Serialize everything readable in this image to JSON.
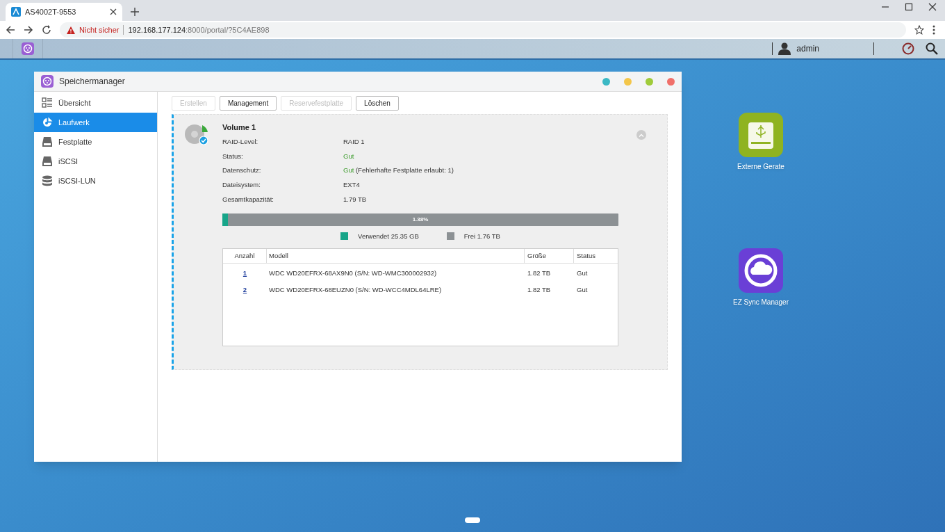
{
  "browser": {
    "tab": {
      "title": "AS4002T-9553"
    },
    "security": "Nicht sicher",
    "url": {
      "host": "192.168.177.124",
      "path": ":8000/portal/?5C4AE898"
    }
  },
  "taskbar": {
    "user": "admin"
  },
  "window": {
    "title": "Speichermanager"
  },
  "sidebar": {
    "items": [
      {
        "label": "Übersicht",
        "kind": "overview",
        "selected": false
      },
      {
        "label": "Laufwerk",
        "kind": "volume",
        "selected": true
      },
      {
        "label": "Festplatte",
        "kind": "disk",
        "selected": false
      },
      {
        "label": "iSCSI",
        "kind": "disk",
        "selected": false
      },
      {
        "label": "iSCSI-LUN",
        "kind": "stack",
        "selected": false
      }
    ]
  },
  "toolbar": {
    "buttons": [
      {
        "label": "Erstellen",
        "disabled": true
      },
      {
        "label": "Management",
        "disabled": false
      },
      {
        "label": "Reservefestplatte",
        "disabled": true
      },
      {
        "label": "Löschen",
        "disabled": false
      }
    ]
  },
  "volume": {
    "name": "Volume 1",
    "properties": [
      {
        "label": "RAID-Level:",
        "value": "RAID 1",
        "kind": "plain"
      },
      {
        "label": "Status:",
        "value": "Gut",
        "kind": "status"
      },
      {
        "label": "Datenschutz:",
        "value": "Gut",
        "note": "(Fehlerhafte Festplatte erlaubt: 1)",
        "kind": "status"
      },
      {
        "label": "Dateisystem:",
        "value": "EXT4",
        "kind": "plain"
      },
      {
        "label": "Gesamtkapazität:",
        "value": "1.79 TB",
        "kind": "plain"
      }
    ],
    "usage": {
      "level": 0.0138,
      "label": "1.38%"
    },
    "legend": [
      {
        "label": "Verwendet 25.35 GB",
        "color": "#17a589"
      },
      {
        "label": "Frei 1.76 TB",
        "color": "#8c9194"
      }
    ],
    "table": {
      "columns": [
        "Anzahl",
        "Modell",
        "Größe",
        "Status"
      ],
      "rows": [
        [
          "1",
          "WDC WD20EFRX-68AX9N0 (S/N: WD-WMC300002932)",
          "1.82 TB",
          "Gut"
        ],
        [
          "2",
          "WDC WD20EFRX-68EUZN0 (S/N: WD-WCC4MDL64LRE)",
          "1.82 TB",
          "Gut"
        ]
      ]
    }
  },
  "desktop": {
    "icons": [
      {
        "label": "Externe Gerate",
        "kind": "usb"
      },
      {
        "label": "EZ Sync Manager",
        "kind": "sync"
      }
    ]
  }
}
